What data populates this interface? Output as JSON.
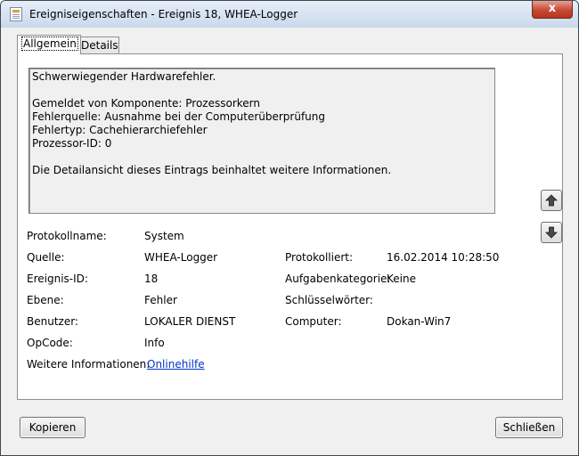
{
  "window": {
    "title": "Ereigniseigenschaften - Ereignis 18, WHEA-Logger",
    "close_glyph": "x"
  },
  "tabs": [
    {
      "label": "Allgemein",
      "active": true
    },
    {
      "label": "Details",
      "active": false
    }
  ],
  "description": {
    "lines": [
      "Schwerwiegender Hardwarefehler.",
      "",
      "Gemeldet von Komponente: Prozessorkern",
      "Fehlerquelle: Ausnahme bei der Computerüberprüfung",
      "Fehlertyp: Cachehierarchiefehler",
      "Prozessor-ID: 0",
      "",
      "Die Detailansicht dieses Eintrags beinhaltet weitere Informationen."
    ]
  },
  "nav": {
    "up_icon": "arrow-up-icon",
    "down_icon": "arrow-down-icon"
  },
  "fields": {
    "protokollname": {
      "label": "Protokollname:",
      "value": "System"
    },
    "quelle": {
      "label": "Quelle:",
      "value": "WHEA-Logger"
    },
    "protokolliert": {
      "label": "Protokolliert:",
      "value": "16.02.2014 10:28:50"
    },
    "ereignis_id": {
      "label": "Ereignis-ID:",
      "value": "18"
    },
    "aufgabenkategorie": {
      "label": "Aufgabenkategorie:",
      "value": "Keine"
    },
    "ebene": {
      "label": "Ebene:",
      "value": "Fehler"
    },
    "schluesselwoerter": {
      "label": "Schlüsselwörter:",
      "value": ""
    },
    "benutzer": {
      "label": "Benutzer:",
      "value": "LOKALER DIENST"
    },
    "computer": {
      "label": "Computer:",
      "value": "Dokan-Win7"
    },
    "opcode": {
      "label": "OpCode:",
      "value": "Info"
    },
    "weitere_informationen": {
      "label": "Weitere Informationen:",
      "link": "Onlinehilfe"
    }
  },
  "buttons": {
    "copy": "Kopieren",
    "close": "Schließen"
  },
  "colors": {
    "link": "#0033cc",
    "close_button": "#c74a35",
    "titlebar": "#c9d9ec"
  }
}
